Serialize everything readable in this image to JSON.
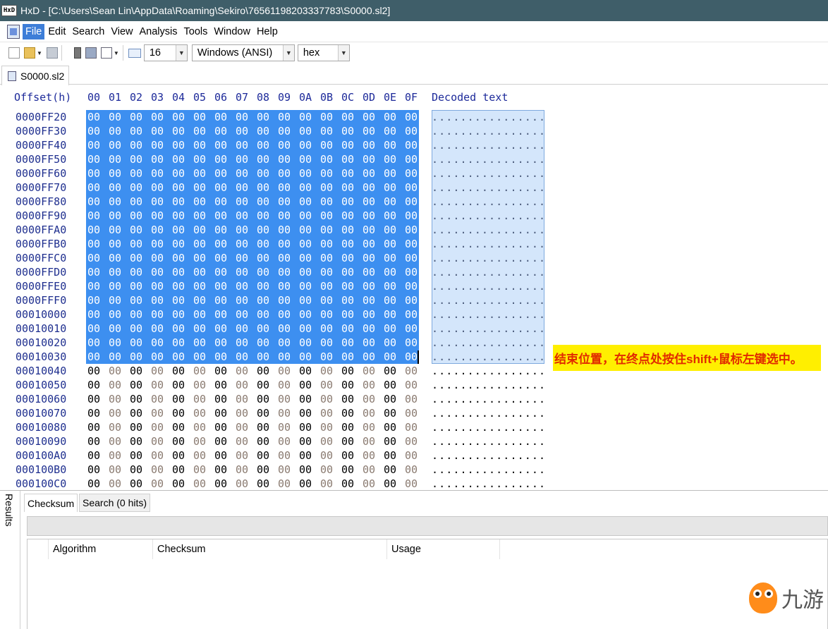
{
  "window": {
    "app_icon": "HxD",
    "title": "HxD - [C:\\Users\\Sean Lin\\AppData\\Roaming\\Sekiro\\76561198203337783\\S0000.sl2]"
  },
  "menu": {
    "items": [
      "File",
      "Edit",
      "Search",
      "View",
      "Analysis",
      "Tools",
      "Window",
      "Help"
    ],
    "active": "File"
  },
  "toolbar": {
    "icons": [
      "new-file-icon",
      "open-icon",
      "save-icon",
      "book-icon",
      "disk-icon",
      "page-icon",
      "columns-icon"
    ],
    "bytes_per_row": "16",
    "charset": "Windows (ANSI)",
    "offset_base": "hex"
  },
  "document_tab": {
    "label": "S0000.sl2"
  },
  "hex_view": {
    "offset_header": "Offset(h)",
    "column_headers": [
      "00",
      "01",
      "02",
      "03",
      "04",
      "05",
      "06",
      "07",
      "08",
      "09",
      "0A",
      "0B",
      "0C",
      "0D",
      "0E",
      "0F"
    ],
    "decoded_header": "Decoded text",
    "rows": [
      {
        "offset": "0000FF20",
        "selected": true
      },
      {
        "offset": "0000FF30",
        "selected": true
      },
      {
        "offset": "0000FF40",
        "selected": true
      },
      {
        "offset": "0000FF50",
        "selected": true
      },
      {
        "offset": "0000FF60",
        "selected": true
      },
      {
        "offset": "0000FF70",
        "selected": true
      },
      {
        "offset": "0000FF80",
        "selected": true
      },
      {
        "offset": "0000FF90",
        "selected": true
      },
      {
        "offset": "0000FFA0",
        "selected": true
      },
      {
        "offset": "0000FFB0",
        "selected": true
      },
      {
        "offset": "0000FFC0",
        "selected": true
      },
      {
        "offset": "0000FFD0",
        "selected": true
      },
      {
        "offset": "0000FFE0",
        "selected": true
      },
      {
        "offset": "0000FFF0",
        "selected": true
      },
      {
        "offset": "00010000",
        "selected": true
      },
      {
        "offset": "00010010",
        "selected": true
      },
      {
        "offset": "00010020",
        "selected": true
      },
      {
        "offset": "00010030",
        "selected": true
      },
      {
        "offset": "00010040",
        "selected": false
      },
      {
        "offset": "00010050",
        "selected": false
      },
      {
        "offset": "00010060",
        "selected": false
      },
      {
        "offset": "00010070",
        "selected": false
      },
      {
        "offset": "00010080",
        "selected": false
      },
      {
        "offset": "00010090",
        "selected": false
      },
      {
        "offset": "000100A0",
        "selected": false
      },
      {
        "offset": "000100B0",
        "selected": false
      },
      {
        "offset": "000100C0",
        "selected": false
      }
    ],
    "byte_value": "00",
    "decoded_row": "................",
    "colors": {
      "selection": "#3d8ff0",
      "decoded_selection": "#d4e6fb",
      "header": "#1d2a9a",
      "byte_dark": "#000000",
      "byte_light": "#8a7a70"
    }
  },
  "annotation": {
    "text": "结束位置，在终点处按住shift+鼠标左键选中。",
    "background": "#ffef00",
    "color": "#e12a00"
  },
  "results_panel": {
    "side_label": "Results",
    "tabs": [
      "Checksum",
      "Search (0 hits)"
    ],
    "active_tab": "Checksum",
    "columns": [
      "Algorithm",
      "Checksum",
      "Usage"
    ]
  },
  "watermark": {
    "text": "九游",
    "mascot_icon": "owl-mascot-icon"
  }
}
